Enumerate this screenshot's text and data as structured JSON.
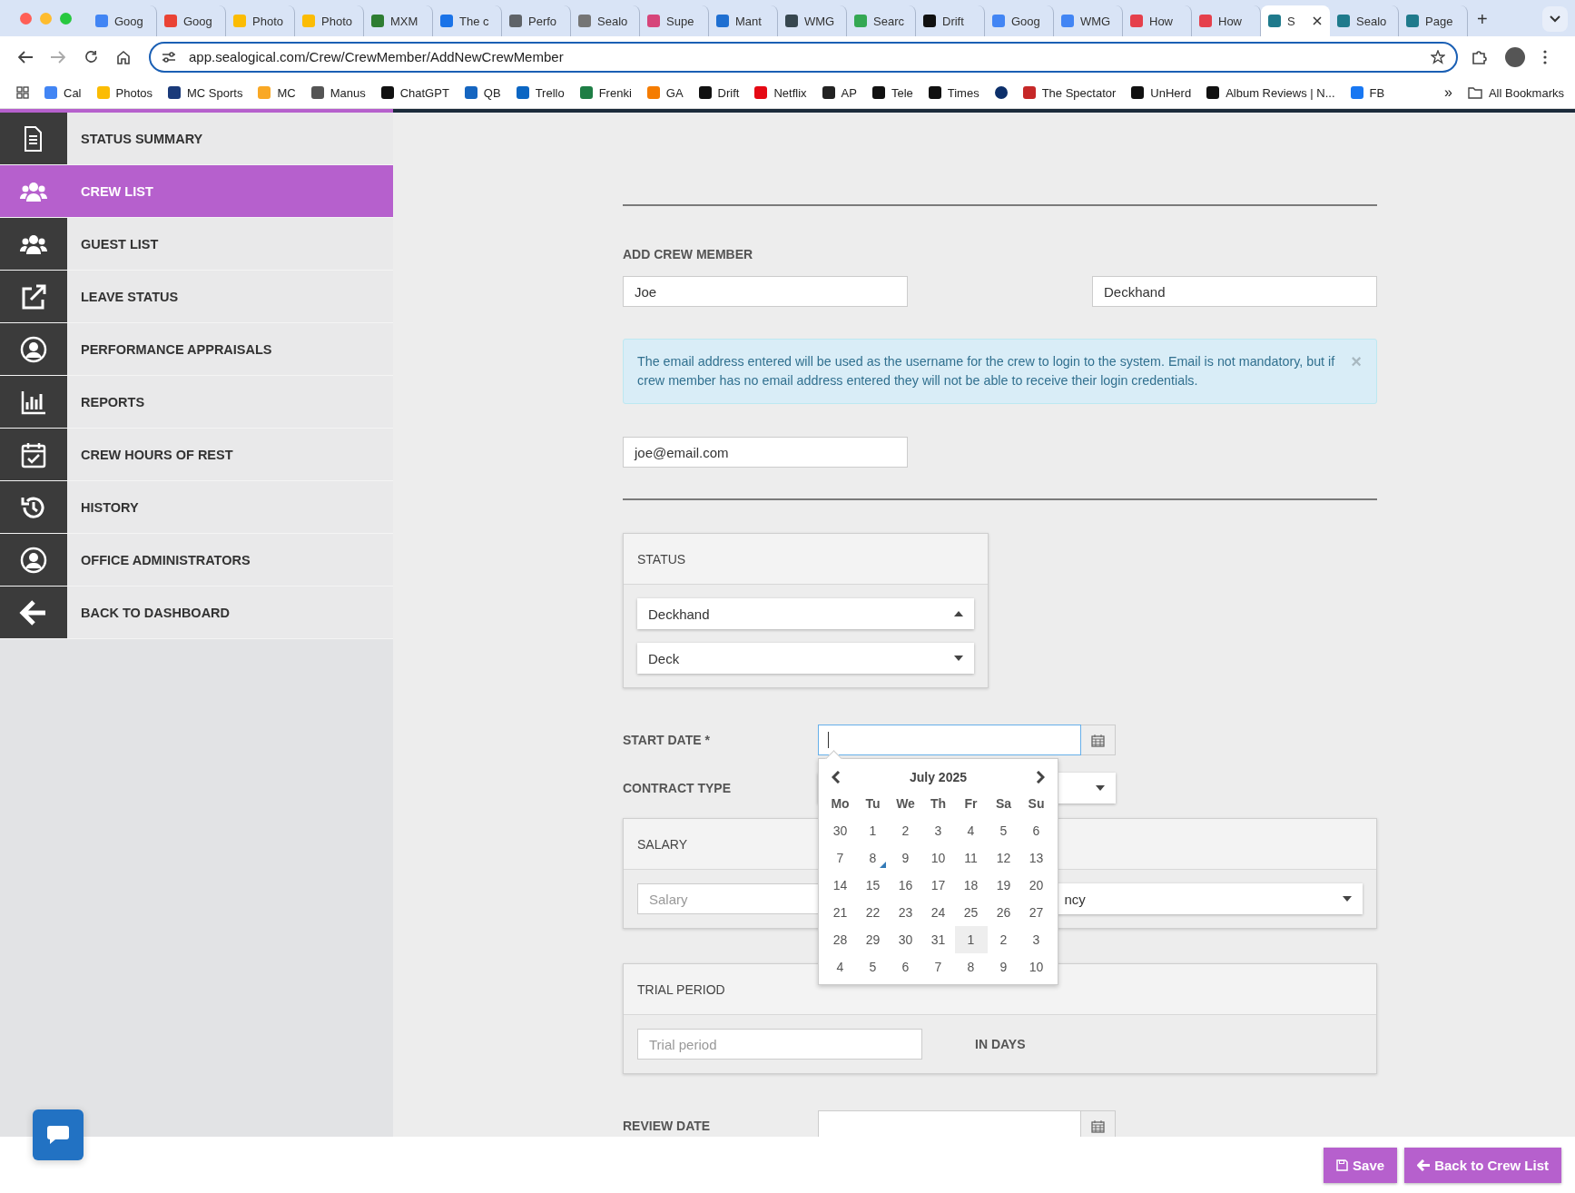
{
  "browser": {
    "tabs": [
      {
        "label": "Goog",
        "selected": false,
        "color": "#4285f4"
      },
      {
        "label": "Goog",
        "selected": false,
        "color": "#ea4335"
      },
      {
        "label": "Photo",
        "selected": false,
        "color": "#fbbc04"
      },
      {
        "label": "Photo",
        "selected": false,
        "color": "#fbbc04"
      },
      {
        "label": "MXM",
        "selected": false,
        "color": "#2e7d32"
      },
      {
        "label": "The c",
        "selected": false,
        "color": "#1a73e8"
      },
      {
        "label": "Perfo",
        "selected": false,
        "color": "#5f6368"
      },
      {
        "label": "Sealo",
        "selected": false,
        "color": "#757575"
      },
      {
        "label": "Supe",
        "selected": false,
        "color": "#d6457a"
      },
      {
        "label": "Mant",
        "selected": false,
        "color": "#1f6fd1"
      },
      {
        "label": "WMG",
        "selected": false,
        "color": "#37474f"
      },
      {
        "label": "Searc",
        "selected": false,
        "color": "#34a853"
      },
      {
        "label": "Drift",
        "selected": false,
        "color": "#111111"
      },
      {
        "label": "Goog",
        "selected": false,
        "color": "#4285f4"
      },
      {
        "label": "WMG",
        "selected": false,
        "color": "#4285f4"
      },
      {
        "label": "How",
        "selected": false,
        "color": "#e5404c"
      },
      {
        "label": "How",
        "selected": false,
        "color": "#e5404c"
      },
      {
        "label": "S",
        "selected": true,
        "color": "#1f7a8c"
      },
      {
        "label": "Sealo",
        "selected": false,
        "color": "#1f7a8c"
      },
      {
        "label": "Page",
        "selected": false,
        "color": "#1f7a8c"
      }
    ],
    "new_tab": "+",
    "url": "app.sealogical.com/Crew/CrewMember/AddNewCrewMember",
    "bookmarks": [
      {
        "label": "Cal",
        "color": "#4285f4"
      },
      {
        "label": "Photos",
        "color": "#fbbc04"
      },
      {
        "label": "MC Sports",
        "color": "#1a3a7a"
      },
      {
        "label": "MC",
        "color": "#f9a825"
      },
      {
        "label": "Manus",
        "color": "#555555"
      },
      {
        "label": "ChatGPT",
        "color": "#111111"
      },
      {
        "label": "QB",
        "color": "#1565c0"
      },
      {
        "label": "Trello",
        "color": "#0b66c3"
      },
      {
        "label": "Frenki",
        "color": "#1e7e45"
      },
      {
        "label": "GA",
        "color": "#f57c00"
      },
      {
        "label": "Drift",
        "color": "#111111"
      },
      {
        "label": "Netflix",
        "color": "#e50914"
      },
      {
        "label": "AP",
        "color": "#222222"
      },
      {
        "label": "Tele",
        "color": "#111111"
      },
      {
        "label": "Times",
        "color": "#111111"
      },
      {
        "color": "#0c2f6a"
      },
      {
        "label": "The Spectator",
        "color": "#c62828"
      },
      {
        "label": "UnHerd",
        "color": "#111111"
      },
      {
        "label": "Album Reviews | N...",
        "color": "#111111"
      },
      {
        "label": "FB",
        "color": "#1877f2"
      }
    ],
    "more": "»",
    "all_bookmarks": "All Bookmarks"
  },
  "sidebar": {
    "items": [
      {
        "label": "STATUS SUMMARY",
        "selected": false
      },
      {
        "label": "CREW LIST",
        "selected": true
      },
      {
        "label": "GUEST LIST",
        "selected": false
      },
      {
        "label": "LEAVE STATUS",
        "selected": false
      },
      {
        "label": "PERFORMANCE APPRAISALS",
        "selected": false
      },
      {
        "label": "REPORTS",
        "selected": false
      },
      {
        "label": "CREW HOURS OF REST",
        "selected": false
      },
      {
        "label": "HISTORY",
        "selected": false
      },
      {
        "label": "OFFICE ADMINISTRATORS",
        "selected": false
      },
      {
        "label": "BACK TO DASHBOARD",
        "selected": false
      }
    ]
  },
  "form": {
    "title": "ADD CREW MEMBER",
    "first_name": {
      "value": "Joe"
    },
    "position": {
      "value": "Deckhand"
    },
    "alert": {
      "text": "The email address entered will be used as the username for the crew to login to the system. Email is not mandatory, but if crew member has no email address entered they will not be able to receive their login credentials.",
      "close": "×"
    },
    "email": {
      "value": "joe@email.com"
    },
    "status": {
      "title": "STATUS",
      "selects": [
        {
          "value": "Deckhand",
          "expanded": true
        },
        {
          "value": "Deck",
          "expanded": false
        }
      ]
    },
    "start_date": {
      "label": "START DATE *",
      "focused": true
    },
    "datepicker": {
      "month": "July 2025",
      "weekdays": [
        "Mo",
        "Tu",
        "We",
        "Th",
        "Fr",
        "Sa",
        "Su"
      ],
      "weeks": [
        [
          {
            "day": "30",
            "today": false,
            "highlighted": false
          },
          {
            "day": "1",
            "today": false,
            "highlighted": false
          },
          {
            "day": "2",
            "today": false,
            "highlighted": false
          },
          {
            "day": "3",
            "today": false,
            "highlighted": false
          },
          {
            "day": "4",
            "today": false,
            "highlighted": false
          },
          {
            "day": "5",
            "today": false,
            "highlighted": false
          },
          {
            "day": "6",
            "today": false,
            "highlighted": false
          }
        ],
        [
          {
            "day": "7",
            "today": false,
            "highlighted": false
          },
          {
            "day": "8",
            "today": true,
            "highlighted": false
          },
          {
            "day": "9",
            "today": false,
            "highlighted": false
          },
          {
            "day": "10",
            "today": false,
            "highlighted": false
          },
          {
            "day": "11",
            "today": false,
            "highlighted": false
          },
          {
            "day": "12",
            "today": false,
            "highlighted": false
          },
          {
            "day": "13",
            "today": false,
            "highlighted": false
          }
        ],
        [
          {
            "day": "14",
            "today": false,
            "highlighted": false
          },
          {
            "day": "15",
            "today": false,
            "highlighted": false
          },
          {
            "day": "16",
            "today": false,
            "highlighted": false
          },
          {
            "day": "17",
            "today": false,
            "highlighted": false
          },
          {
            "day": "18",
            "today": false,
            "highlighted": false
          },
          {
            "day": "19",
            "today": false,
            "highlighted": false
          },
          {
            "day": "20",
            "today": false,
            "highlighted": false
          }
        ],
        [
          {
            "day": "21",
            "today": false,
            "highlighted": false
          },
          {
            "day": "22",
            "today": false,
            "highlighted": false
          },
          {
            "day": "23",
            "today": false,
            "highlighted": false
          },
          {
            "day": "24",
            "today": false,
            "highlighted": false
          },
          {
            "day": "25",
            "today": false,
            "highlighted": false
          },
          {
            "day": "26",
            "today": false,
            "highlighted": false
          },
          {
            "day": "27",
            "today": false,
            "highlighted": false
          }
        ],
        [
          {
            "day": "28",
            "today": false,
            "highlighted": false
          },
          {
            "day": "29",
            "today": false,
            "highlighted": false
          },
          {
            "day": "30",
            "today": false,
            "highlighted": false
          },
          {
            "day": "31",
            "today": false,
            "highlighted": false
          },
          {
            "day": "1",
            "today": false,
            "highlighted": true
          },
          {
            "day": "2",
            "today": false,
            "highlighted": false
          },
          {
            "day": "3",
            "today": false,
            "highlighted": false
          }
        ],
        [
          {
            "day": "4",
            "today": false,
            "highlighted": false
          },
          {
            "day": "5",
            "today": false,
            "highlighted": false
          },
          {
            "day": "6",
            "today": false,
            "highlighted": false
          },
          {
            "day": "7",
            "today": false,
            "highlighted": false
          },
          {
            "day": "8",
            "today": false,
            "highlighted": false
          },
          {
            "day": "9",
            "today": false,
            "highlighted": false
          },
          {
            "day": "10",
            "today": false,
            "highlighted": false
          }
        ]
      ]
    },
    "contract_type": {
      "label": "CONTRACT TYPE",
      "expanded": false
    },
    "salary": {
      "title": "SALARY",
      "amount": {
        "placeholder": "Salary"
      },
      "currency": {
        "value": "ncy",
        "expanded": false
      }
    },
    "trial_period": {
      "title": "TRIAL PERIOD",
      "input": {
        "placeholder": "Trial period"
      },
      "unit": "IN DAYS"
    },
    "review_date": {
      "label": "REVIEW DATE"
    }
  },
  "footer": {
    "buttons": [
      {
        "label": "Save",
        "kind": "save"
      },
      {
        "label": "Back to Crew List",
        "kind": "back"
      }
    ]
  }
}
